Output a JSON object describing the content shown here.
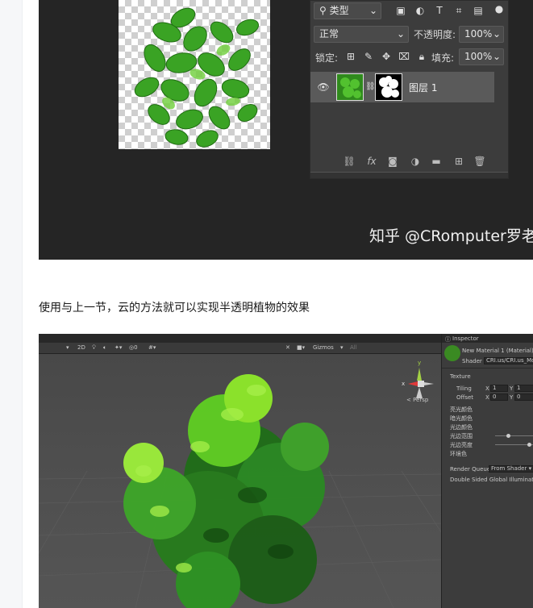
{
  "ps": {
    "filter_label": "类型",
    "blend_mode": "正常",
    "opacity_label": "不透明度:",
    "opacity_value": "100%",
    "lock_label": "锁定:",
    "fill_label": "填充:",
    "fill_value": "100%",
    "layer_name": "图层 1"
  },
  "watermark": "知乎 @CRomputer罗老",
  "caption": "使用与上一节，云的方法就可以实现半透明植物的效果",
  "unity": {
    "toolbar_2d": "2D",
    "gizmos_label": "Gizmos",
    "all_label": "All",
    "persp_label": "< Persp",
    "inspector_tab": "Inspector",
    "material_name": "New Material 1 (Material)",
    "shader_label": "Shader",
    "shader_value": "CRI.us/CRI.us_Mo",
    "texture_label": "Texture",
    "tiling_label": "Tiling",
    "offset_label": "Offset",
    "tiling_x": "1",
    "tiling_y": "1",
    "offset_x": "0",
    "offset_y": "0",
    "x_label": "X",
    "y_label": "Y",
    "prop1": "亮光颜色",
    "prop2": "暗光颜色",
    "prop3": "光边颜色",
    "prop4": "光边范围",
    "prop5": "光边亮度",
    "prop6": "环境色",
    "render_queue_label": "Render Queue",
    "render_queue_value": "From Shader",
    "double_sided_label": "Double Sided Global Illumination"
  },
  "colors": {
    "ps_bg": "#252525",
    "ps_panel": "#3c3c3c",
    "leaf_green": "#3aa324",
    "unity_bg": "#4b4b4b",
    "bush_green": "#7fe01e"
  }
}
